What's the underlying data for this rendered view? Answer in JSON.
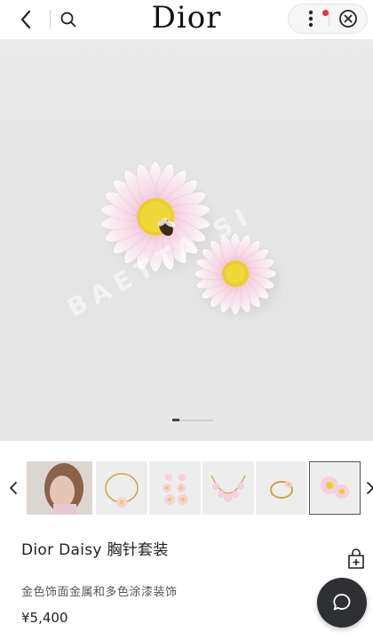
{
  "header": {
    "brand": "Dior",
    "icons": {
      "back": "back-arrow-icon",
      "search": "search-icon",
      "more": "more-vertical-icon",
      "close": "close-circle-icon"
    },
    "colors": {
      "notify_dot": "#e8324a"
    }
  },
  "gallery": {
    "watermark": "BAETTA SI",
    "slide_index": 1,
    "slide_count": 6,
    "thumbnails": [
      {
        "name": "model-earring",
        "selected": false
      },
      {
        "name": "daisy-bracelet",
        "selected": false
      },
      {
        "name": "daisy-drop-earrings",
        "selected": false
      },
      {
        "name": "daisy-necklace",
        "selected": false
      },
      {
        "name": "daisy-ring",
        "selected": false
      },
      {
        "name": "daisy-brooch-set",
        "selected": true
      }
    ]
  },
  "product": {
    "title": "Dior Daisy 胸针套装",
    "subtitle": "金色饰面金属和多色涂漆装饰",
    "price": "¥5,400"
  },
  "actions": {
    "bag_icon": "shopping-bag-add-icon",
    "chat_icon": "chat-bubble-icon",
    "chat_color": "#2f3033"
  }
}
